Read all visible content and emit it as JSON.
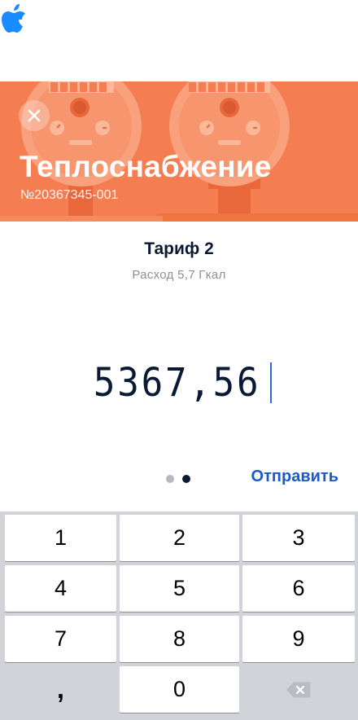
{
  "header": {
    "title": "Теплоснабжение",
    "account_number": "№20367345-001",
    "accent_color": "#f47e52"
  },
  "tariff": {
    "title": "Тариф 2",
    "subtitle": "Расход 5,7 Гкал"
  },
  "reading": {
    "value": "5367,56"
  },
  "pager": {
    "total": 2,
    "active": 2
  },
  "actions": {
    "send_label": "Отправить",
    "send_color": "#1a5bc7"
  },
  "keypad": {
    "keys": [
      "1",
      "2",
      "3",
      "4",
      "5",
      "6",
      "7",
      "8",
      "9",
      ",",
      "0",
      "backspace-icon"
    ]
  }
}
